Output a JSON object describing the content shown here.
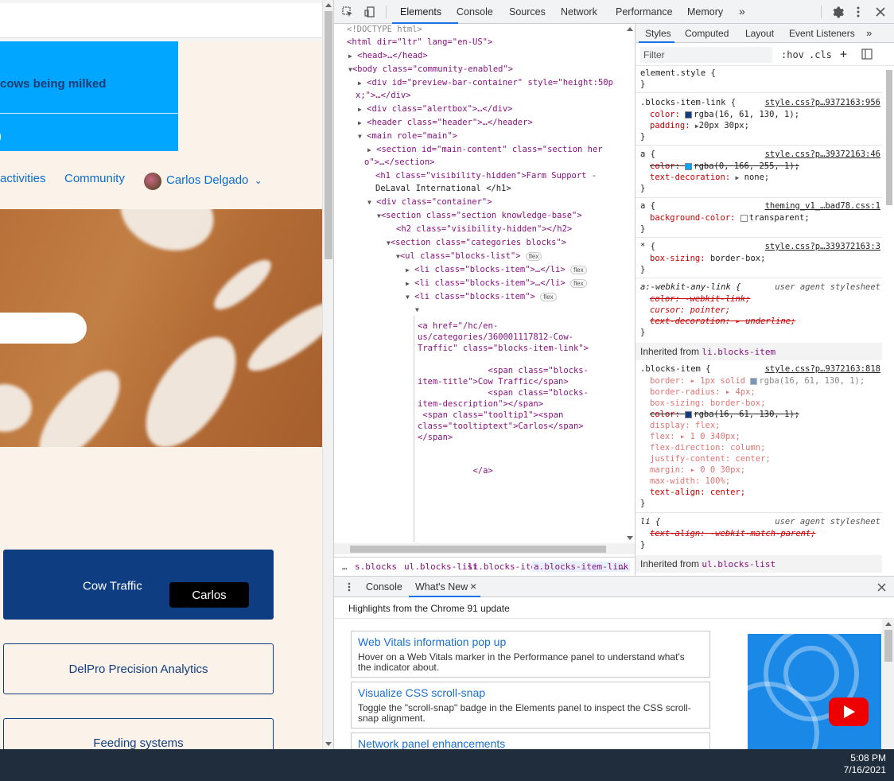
{
  "site": {
    "banner_text": "cows being milked",
    "banner_fragment": ")",
    "nav": [
      {
        "label": "activities"
      },
      {
        "label": "Community"
      },
      {
        "label": "Carlos Delgado"
      }
    ],
    "nav_chevron": "⌄",
    "cards": [
      {
        "title": "Cow Traffic",
        "tooltip": "Carlos"
      },
      {
        "title": "DelPro Precision Analytics"
      },
      {
        "title": "Feeding systems"
      }
    ]
  },
  "devtools": {
    "tabs": [
      "Elements",
      "Console",
      "Sources",
      "Network",
      "Performance",
      "Memory"
    ],
    "active_tab": "Elements",
    "more_tabs": "»",
    "styles_tabs": [
      "Styles",
      "Computed",
      "Layout",
      "Event Listeners"
    ],
    "styles_more": "»",
    "filter_placeholder": "Filter",
    "hov": ":hov",
    "cls": ".cls",
    "dom": {
      "doctype": "<!DOCTYPE html>",
      "html_open": "<html dir=\"ltr\" lang=\"en-US\">",
      "head": "<head>…</head>",
      "body_open": "<body class=\"community-enabled\">",
      "preview_div_1": "<div id=\"preview-bar-container\" style=\"height:50p",
      "preview_div_2": "x;\">…</div>",
      "alertbox": "<div class=\"alertbox\">…</div>",
      "header": "<header class=\"header\">…</header>",
      "main_open": "<main role=\"main\">",
      "section_main_1": "<section id=\"main-content\" class=\"section her",
      "section_main_2": "o\">…</section>",
      "h1_1": "<h1 class=\"visibility-hidden\">Farm Support -",
      "h1_2": "DeLaval International </h1>",
      "container": "<div class=\"container\">",
      "section_kb": "<section class=\"section knowledge-base\">",
      "h2": "<h2 class=\"visibility-hidden\"></h2>",
      "section_cat": "<section class=\"categories blocks\">",
      "ul": "<ul class=\"blocks-list\">",
      "li_1": "<li class=\"blocks-item\">…</li>",
      "li_2": "<li class=\"blocks-item\">…</li>",
      "li_3": "<li class=\"blocks-item\">",
      "flex_badge": "flex",
      "editor_lines": [
        "<a href=\"/hc/en-",
        "us/categories/360001117812-Cow-",
        "Traffic\" class=\"blocks-item-link\">",
        "",
        "",
        "              <span class=\"blocks-",
        "item-title\">Cow Traffic</span>",
        "              <span class=\"blocks-",
        "item-description\"></span>",
        " <span class=\"tooltip1\"><span",
        "class=\"tooltiptext\">Carlos</span>",
        "</span>",
        "",
        "",
        "           </a>"
      ]
    },
    "breadcrumb": [
      "…",
      "s.blocks",
      "ul.blocks-list",
      "li.blocks-item",
      "a.blocks-item-link",
      "…"
    ],
    "styles": {
      "element_style": "element.style {",
      "rule1_selector": ".blocks-item-link {",
      "rule1_source": "style.css?p…9372163:956",
      "rule1_color_prop": "color:",
      "rule1_color_val": "rgba(16, 61, 130, 1);",
      "rule1_color_hex": "#103d82",
      "rule1_padding_prop": "padding:",
      "rule1_padding_val": "20px 30px;",
      "rule2_selector": "a {",
      "rule2_source": "style.css?p…39372163:46",
      "rule2_color_prop": "color:",
      "rule2_color_val": "rgba(0, 166, 255, 1);",
      "rule2_color_hex": "#00a6ff",
      "rule2_td_prop": "text-decoration:",
      "rule2_td_val": "none;",
      "rule3_selector": "a {",
      "rule3_source": "theming_v1_…bad78.css:1",
      "rule3_bg_prop": "background-color:",
      "rule3_bg_val": "transparent;",
      "rule4_selector": "* {",
      "rule4_source": "style.css?p…339372163:3",
      "rule4_bs_prop": "box-sizing:",
      "rule4_bs_val": "border-box;",
      "rule5_selector": "a:-webkit-any-link {",
      "rule5_source": "user agent stylesheet",
      "rule5_l1": "color: -webkit-link;",
      "rule5_l2": "cursor: pointer;",
      "rule5_l3": "text-decoration: ▸ underline;",
      "inherited_1_prefix": "Inherited from",
      "inherited_1_sel": "li.blocks-item",
      "rule6_selector": ".blocks-item {",
      "rule6_source": "style.css?p…9372163:818",
      "rule6_border": "border: ▸ 1px solid",
      "rule6_border_color": "rgba(16, 61, 130, 1);",
      "rule6_radius": "border-radius: ▸ 4px;",
      "rule6_boxsizing": "box-sizing: border-box;",
      "rule6_color": "color:",
      "rule6_color_val": "rgba(16, 61, 130, 1);",
      "rule6_display": "display: flex;",
      "rule6_flex": "flex: ▸ 1 0 340px;",
      "rule6_fd": "flex-direction: column;",
      "rule6_jc": "justify-content: center;",
      "rule6_margin": "margin: ▸ 0 0 30px;",
      "rule6_maxw": "max-width: 100%;",
      "rule6_ta": "text-align: center;",
      "rule7_selector": "li {",
      "rule7_source": "user agent stylesheet",
      "rule7_l1": "text-align: -webkit-match-parent;",
      "inherited_2_prefix": "Inherited from",
      "inherited_2_sel": "ul.blocks-list"
    },
    "drawer": {
      "tabs": [
        "Console",
        "What's New"
      ],
      "close_x": "×",
      "header": "Highlights from the Chrome 91 update",
      "items": [
        {
          "title": "Web Vitals information pop up",
          "desc": "Hover on a Web Vitals marker in the Performance panel to understand what's the indicator about."
        },
        {
          "title": "Visualize CSS scroll-snap",
          "desc": "Toggle the \"scroll-snap\" badge in the Elements panel to inspect the CSS scroll-snap alignment."
        },
        {
          "title": "Network panel enhancements",
          "desc": ""
        }
      ]
    }
  },
  "taskbar": {
    "time": "5:08 PM",
    "date": "7/16/2021"
  },
  "colors": {
    "site_blue": "#00a6ff",
    "site_navy": "#0f3d82",
    "site_cream": "#fbf3ea",
    "devtools_accent": "#1a73e8"
  }
}
